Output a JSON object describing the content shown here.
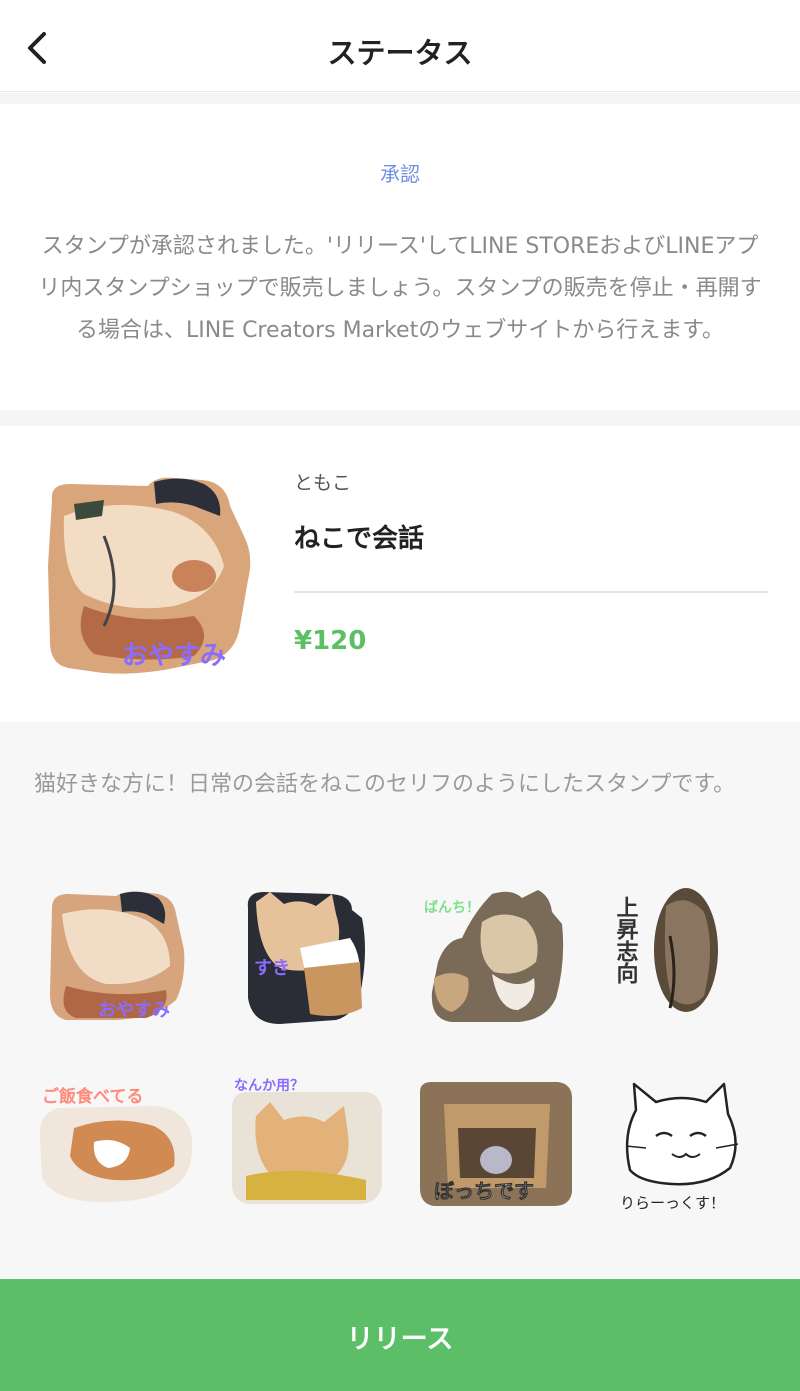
{
  "header": {
    "title": "ステータス",
    "back_icon": "chevron-left-icon"
  },
  "status": {
    "label": "承認",
    "message": "スタンプが承認されました。'リリース'してLINE STOREおよびLINEアプリ内スタンプショップで販売しましょう。スタンプの販売を停止・再開する場合は、LINE Creators Marketのウェブサイトから行えます。"
  },
  "product": {
    "creator": "ともこ",
    "title": "ねこで会話",
    "price": "¥120",
    "thumbnail_caption": "おやすみ"
  },
  "description": {
    "text": "猫好きな方に！日常の会話をねこのセリフのようにしたスタンプです。"
  },
  "stickers": [
    {
      "caption": "おやすみ",
      "caption_color": "#8a6cff"
    },
    {
      "caption": "すき",
      "caption_color": "#8a6cff"
    },
    {
      "caption": "ばんち！",
      "caption_color": "#7ee08a"
    },
    {
      "caption": "上昇志向",
      "caption_color": "#333333"
    },
    {
      "caption": "ご飯食べてる",
      "caption_color": "#ff8a7a"
    },
    {
      "caption": "なんか用？",
      "caption_color": "#8a6cff"
    },
    {
      "caption": "ぼっちです",
      "caption_color": "#ffffff"
    },
    {
      "caption": "りらーっくす！",
      "caption_color": "#222222"
    }
  ],
  "release_button": {
    "label": "リリース"
  },
  "colors": {
    "accent_green": "#5cbf67",
    "price_green": "#5bbf63",
    "status_blue": "#6f8fe0"
  }
}
